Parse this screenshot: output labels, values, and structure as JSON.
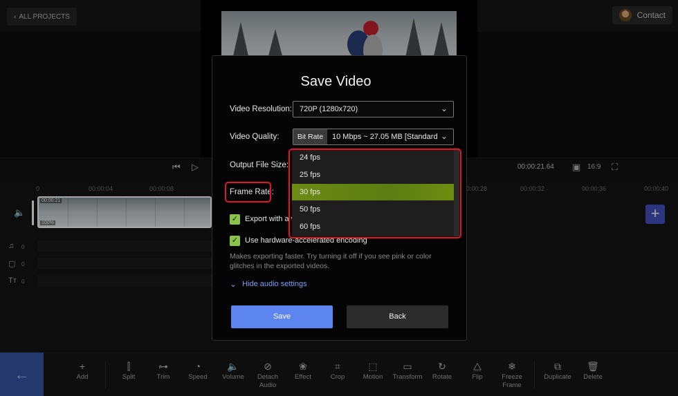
{
  "topbar": {
    "back_label": "ALL PROJECTS",
    "contact_label": "Contact"
  },
  "playback": {
    "time": "00:00:21.64",
    "aspect": "16:9"
  },
  "ruler": [
    "0",
    "00:00:04",
    "00:00:08",
    "00:00:28",
    "00:00:32",
    "00:00:36",
    "00:00:40"
  ],
  "clip": {
    "duration": "00:00:21",
    "volume": "100%"
  },
  "tracks": [
    {
      "icon": "music-note-icon",
      "count": "0"
    },
    {
      "icon": "sticker-icon",
      "count": "0"
    },
    {
      "icon": "text-icon",
      "count": "0"
    }
  ],
  "toolbar": {
    "items": [
      "Add",
      "Split",
      "Trim",
      "Speed",
      "Volume",
      "Detach Audio",
      "Effect",
      "Crop",
      "Motion",
      "Transform",
      "Rotate",
      "Flip",
      "Freeze Frame",
      "Duplicate",
      "Delete"
    ]
  },
  "modal": {
    "title": "Save Video",
    "resolution_label": "Video Resolution:",
    "resolution_value": "720P (1280x720)",
    "quality_label": "Video Quality:",
    "quality_tag": "Bit Rate",
    "quality_value": "10 Mbps ~ 27.05 MB [Standard",
    "output_label": "Output File Size:",
    "frame_rate_label": "Frame Rate:",
    "frame_rate_options": [
      "24 fps",
      "25 fps",
      "30 fps",
      "50 fps",
      "60 fps"
    ],
    "frame_rate_selected": "30 fps",
    "export_label": "Export with a v",
    "hw_label": "Use hardware-accelerated encoding",
    "hw_hint": "Makes exporting faster. Try turning it off if you see pink or color glitches in the exported videos.",
    "hide_audio": "Hide audio settings",
    "save_label": "Save",
    "back_label": "Back"
  },
  "colors": {
    "accent": "#5c85f0",
    "check": "#8bc34a",
    "selected_option": "#6e8a14",
    "highlight": "#e0142a"
  }
}
